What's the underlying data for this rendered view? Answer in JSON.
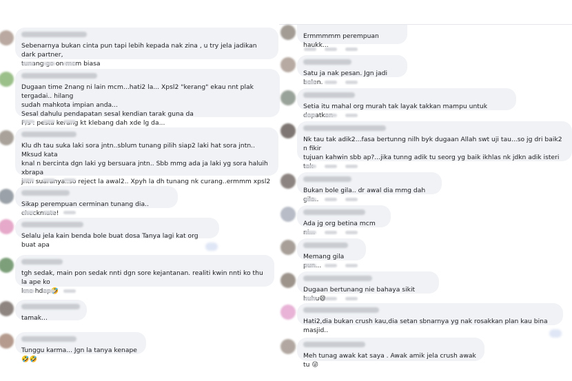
{
  "left_comments": [
    {
      "text": "Sebenarnya bukan cinta pun tapi lebih kepada nak zina , u try jela jadikan dark partner,\ntunang go on mcm biasa",
      "avatar_color": "#b9a9a0"
    },
    {
      "text": "Dugaan time 2nang ni lain mcm...hati2 la... Xpsl2 \"kerang\" ekau nnt plak tergadai.. hilang\nsudah mahkota impian anda...\nSesal dahulu pendapatan sesal kendian tarak guna da\nP/s : pesta kerang kt klebang dah xde lg da...",
      "avatar_color": "#9cc08a"
    },
    {
      "text": "Klu dh tau suka laki sora jntn..sblum tunang pilih siap2 laki hat sora jntn.. Mksud kata\nknal n bercinta dgn laki yg bersuara jntn.. Sbb mmg ada ja laki yg sora haluih xbrapa\njntn suaranya..so reject la awal2.. Xpyh la dh tunang nk curang..ermmm xpsl2\nmengcomplicatedkan hdup mu huhu",
      "avatar_color": "#a9a29a"
    },
    {
      "text": "Sikap perempuan cerminan tunang dia.. checkmate!",
      "avatar_color": "#9aa1a8"
    },
    {
      "text": "Selalu jela kain benda bole buat dosa Tanya lagi kat org buat apa",
      "avatar_color": "#e6a9c9"
    },
    {
      "text": "tgh sedak, main pon sedak nnti dgn sore kejantanan. realiti kwin nnti ko thu la ape ko\nkne hdap🤣",
      "avatar_color": "#7da07a"
    },
    {
      "text": "tamak...",
      "avatar_color": "#8e8580"
    },
    {
      "text": "Tunggu karma... Jgn la tanya kenape🤣🤣",
      "avatar_color": "#b59b8e"
    }
  ],
  "right_comments": [
    {
      "text": "Ermmmmm perempuan haukk...",
      "avatar_color": "#a39c95"
    },
    {
      "text": "Satu ja nak pesan. Jgn jadi belen.",
      "avatar_color": "#b7aaa2"
    },
    {
      "text": "Setia itu mahal org murah tak layak takkan mampu untuk dapatkan",
      "avatar_color": "#9aa39a"
    },
    {
      "text": "Nk tau tak adik2...fasa bertunng nilh byk dugaan Allah swt uji tau...so jg dri baik2 n fikir\ntujuan kahwin sbb ap?...jika tunng adik tu seorg yg baik ikhlas nk jdkn adik isteri tak\npayahlh duk layan lelaki lain k..",
      "avatar_color": "#7e7672"
    },
    {
      "text": "Bukan bole gila.. dr awal dia mmg dah gila..",
      "avatar_color": "#8c8480"
    },
    {
      "text": "Ada jg org betina mcm ni...",
      "avatar_color": "#b7bcc6"
    },
    {
      "text": "Memang gila pun...",
      "avatar_color": "#a79f98"
    },
    {
      "text": "Dugaan bertunang nie bahaya sikit huhu😅",
      "avatar_color": "#9d948c"
    },
    {
      "text": "Hati2,dia bukan crush kau,dia setan sbnarnya yg nak rosakkan plan kau bina masjid..",
      "avatar_color": "#e8b3d6"
    },
    {
      "text": "Meh tunag awak kat saya . Awak amik jela crush awak tu 😜",
      "avatar_color": "#b2a8a1"
    }
  ]
}
